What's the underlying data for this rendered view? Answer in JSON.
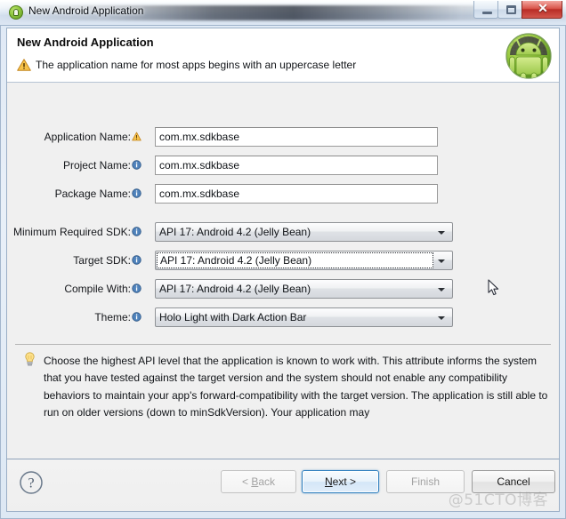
{
  "window": {
    "title": "New Android Application",
    "icon": "android-circle-icon",
    "controls": {
      "minimize": "minimize-button",
      "maximize": "maximize-button",
      "close_glyph": "✕"
    }
  },
  "header": {
    "title": "New Android Application",
    "message": "The application name for most apps begins with an uppercase letter",
    "message_icon": "warning-triangle-icon",
    "logo": "android-mascot-logo"
  },
  "form": {
    "text_fields": [
      {
        "label": "Application Name:",
        "icon": "warning-triangle-icon",
        "value": "com.mx.sdkbase"
      },
      {
        "label": "Project Name:",
        "icon": "info-circle-icon",
        "value": "com.mx.sdkbase"
      },
      {
        "label": "Package Name:",
        "icon": "info-circle-icon",
        "value": "com.mx.sdkbase"
      }
    ],
    "combos": [
      {
        "label": "Minimum Required SDK:",
        "icon": "info-circle-icon",
        "value": "API 17: Android 4.2 (Jelly Bean)",
        "focused": false
      },
      {
        "label": "Target SDK:",
        "icon": "info-circle-icon",
        "value": "API 17: Android 4.2 (Jelly Bean)",
        "focused": true
      },
      {
        "label": "Compile With:",
        "icon": "info-circle-icon",
        "value": "API 17: Android 4.2 (Jelly Bean)",
        "focused": false
      },
      {
        "label": "Theme:",
        "icon": "info-circle-icon",
        "value": "Holo Light with Dark Action Bar",
        "focused": false
      }
    ]
  },
  "help": {
    "icon": "lightbulb-icon",
    "text": "Choose the highest API level that the application is known to work with. This attribute informs the system that you have tested against the target version and the system should not enable any compatibility behaviors to maintain your app's forward-compatibility with the target version. The application is still able to run on older versions (down to minSdkVersion). Your application may"
  },
  "footer": {
    "help_button": "help-question-button",
    "buttons": [
      {
        "label": "< Back",
        "mnemonic": "B",
        "state": "disabled",
        "name": "back-button"
      },
      {
        "label": "Next >",
        "mnemonic": "N",
        "state": "default",
        "name": "next-button"
      },
      {
        "label": "Finish",
        "mnemonic": "",
        "state": "disabled",
        "name": "finish-button"
      },
      {
        "label": "Cancel",
        "mnemonic": "",
        "state": "normal",
        "name": "cancel-button"
      }
    ]
  },
  "watermark": "@51CTO博客",
  "colors": {
    "accent": "#2f7fbf",
    "android_green": "#8ec63f",
    "warning": "#e8a33d",
    "info": "#3a6ea5",
    "form_bg": "#f0f0f0",
    "close_red": "#b92d26"
  }
}
